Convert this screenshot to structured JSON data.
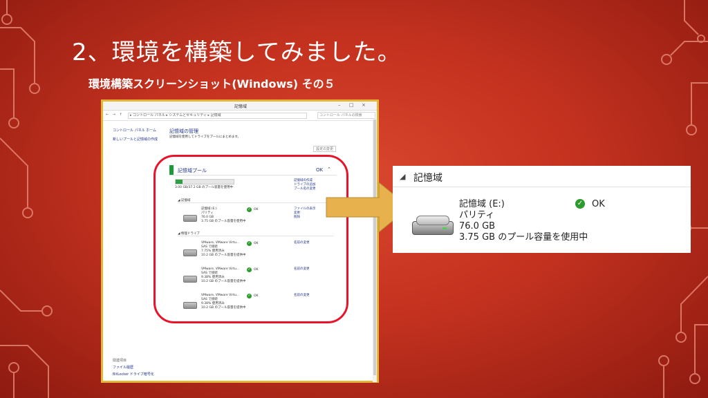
{
  "slide": {
    "title": "2、環境を構築してみました。",
    "subtitle": "環境構築スクリーンショット(Windows) その５"
  },
  "window": {
    "title": "記憶域",
    "controls": [
      "–",
      "□",
      "×"
    ],
    "nav": "← → ↑",
    "path": "▸ コントロール パネル ▸ システムとセキュリティ ▸ 記憶域",
    "search_placeholder": "コントロール パネルの検索",
    "left_nav": [
      "コントロール パネル ホーム",
      "新しいプールと記憶域の作成"
    ],
    "left_bottom_heading": "関連項目",
    "left_bottom": [
      "ファイル履歴",
      "BitLocker ドライブ暗号化"
    ],
    "manager_title": "記憶域の管理",
    "manager_desc": "記憶域を使用してドライブをプールにまとめます。",
    "change_button": "設定の変更",
    "pool": {
      "label": "記憶域プール",
      "status": "OK",
      "capacity": "3.00 GB/37.2 GB のプール容量を使用中",
      "tasks": [
        "記憶域の作成",
        "ドライブの追加",
        "プール名の変更"
      ],
      "section_spaces": "記憶域",
      "space": {
        "name": "記憶域 (E:)",
        "type": "パリティ",
        "size": "76.0 GB",
        "usage": "3.75 GB のプール容量を使用中",
        "status": "OK",
        "links": [
          "ファイルの表示",
          "変更",
          "削除"
        ]
      },
      "section_drives": "物理ドライブ",
      "drives": [
        {
          "name": "VMware, VMware Virtu...",
          "type": "SAS で接続",
          "used": "7.75% 使用済み",
          "cap": "10.2 GB のプール容量を提供中",
          "status": "OK",
          "link": "名前の変更"
        },
        {
          "name": "VMware, VMware Virtu...",
          "type": "SAS で接続",
          "used": "9.38% 使用済み",
          "cap": "10.2 GB のプール容量を提供中",
          "status": "OK",
          "link": "名前の変更"
        },
        {
          "name": "VMware, VMware Virtu...",
          "type": "SAS で接続",
          "used": "9.38% 使用済み",
          "cap": "10.2 GB のプール容量を提供中",
          "status": "OK",
          "link": "名前の変更"
        }
      ]
    }
  },
  "zoom": {
    "header": "記憶域",
    "name": "記憶域 (E:)",
    "type": "パリティ",
    "size": "76.0 GB",
    "usage": "3.75 GB のプール容量を使用中",
    "status": "OK"
  },
  "colors": {
    "background": "#c4321f",
    "highlight_oval": "#e8132a",
    "arrow": "#e7b24d",
    "ok_green": "#2e9b2e"
  }
}
